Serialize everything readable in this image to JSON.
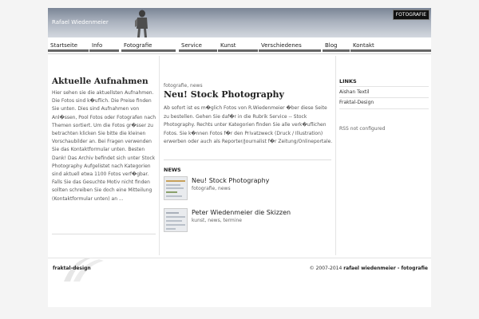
{
  "header": {
    "site_title": "Rafael Wiedenmeier",
    "badge": "FOTOGRAFIE"
  },
  "nav": {
    "items": [
      {
        "label": "Startseite"
      },
      {
        "label": "Info"
      },
      {
        "label": "Fotografie"
      },
      {
        "label": "Service"
      },
      {
        "label": "Kunst"
      },
      {
        "label": "Verschiedenes"
      },
      {
        "label": "Blog"
      },
      {
        "label": "Kontakt"
      }
    ]
  },
  "left": {
    "heading": "Aktuelle Aufnahmen",
    "text": "Hier sehen sie die aktuellsten Aufnahmen. Die Fotos sind k�uflich. Die Preise finden Sie unten. Dies sind Aufnahmen von Anl�ssen, Pool Fotos oder Fotografen nach Themen sortiert. Um die Fotos gr�sser zu betrachten klicken Sie bitte die kleinen Vorschaubilder an. Bei Fragen verwenden Sie das Kontaktformular unten. Besten Dank! Das Archiv befindet sich unter Stock Photography Aufgelistet nach Kategorien sind aktuell etwa 1100 Fotos verf�gbar. Falls Sie das Gesuchte Motiv nicht finden sollten schreiben Sie doch eine Mitteilung (Kontaktformular unten) an ..."
  },
  "main": {
    "post": {
      "categories": "fotografie, news",
      "title": "Neu! Stock Photography",
      "text": "Ab sofort ist es m�glich Fotos von R.Wiedenmeier �ber diese Seite zu bestellen. Gehen Sie daf�r in die Rubrik Service -- Stock Photography. Rechts unter Kategorien finden Sie alle verk�uflichen Fotos. Sie k�nnen Fotos f�r den Privatzweck (Druck / Illustration) erwerben oder auch als Reporter/Journalist f�r Zeitung/Onlineportale."
    },
    "news_heading": "NEWS",
    "news": [
      {
        "title": "Neu! Stock Photography",
        "categories": "fotografie, news"
      },
      {
        "title": "Peter Wiedenmeier die Skizzen",
        "categories": "kunst, news, termine"
      }
    ]
  },
  "right": {
    "links_heading": "LINKS",
    "links": [
      {
        "label": "Aishan Textil"
      },
      {
        "label": "Fraktal-Design"
      }
    ],
    "rss": "RSS not configured"
  },
  "footer": {
    "logo": "fraktal-design",
    "copyright_prefix": "© 2007-2014 ",
    "copyright_owner": "rafael wiedenmeier - fotografie"
  },
  "colors": {
    "header_top": "#7a8596",
    "header_bottom": "#d3d8df",
    "nav_underline": "#666666"
  }
}
